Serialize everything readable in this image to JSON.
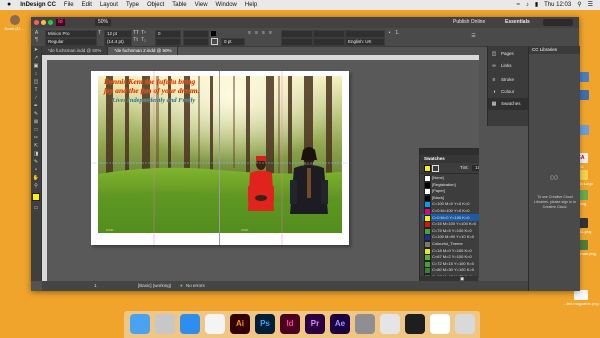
{
  "menubar": {
    "app_name": "InDesign CC",
    "items": [
      "File",
      "Edit",
      "Layout",
      "Type",
      "Object",
      "Table",
      "View",
      "Window",
      "Help"
    ],
    "clock": "Thu 12:03"
  },
  "desktop": {
    "user_label": "Noah (£1 ...",
    "icons": [
      "EA",
      "Ricardo Lego",
      "...png",
      "...ck-11.png",
      "...Fuchsman.png",
      "...ted magazine.png"
    ]
  },
  "indesign": {
    "zoom": "50%",
    "publish_online": "Publish Online",
    "workspace": "Essentials",
    "tabs": [
      "*de fuchsman.indd @ 50%",
      "*de fuchsman 2.indd @ 50%"
    ],
    "control": {
      "font": "Minion Pro",
      "style": "Regular",
      "size": "12 pt",
      "leading": "(14.4 pt)",
      "tracking": "0",
      "stroke": "0 pt",
      "language": "English: UK"
    }
  },
  "document": {
    "headline_line1": "Dennis Kent the fufulu bring",
    "headline_line2": "joy and the fun of your dream.",
    "subheadline": "Lives Independently and Freely"
  },
  "swatches": {
    "title": "Swatches",
    "tint_label": "Tint:",
    "tint_value": "100",
    "items": [
      {
        "label": "[None]",
        "color": "#ffffff"
      },
      {
        "label": "[Registration]",
        "color": "#000000"
      },
      {
        "label": "[Paper]",
        "color": "#ffffff"
      },
      {
        "label": "[Black]",
        "color": "#000000"
      },
      {
        "label": "C=100 M=0 Y=0 K=0",
        "color": "#00a0e9"
      },
      {
        "label": "C=0 M=100 Y=0 K=0",
        "color": "#e4007f"
      },
      {
        "label": "C=0 M=0 Y=100 K=0",
        "color": "#fff100",
        "selected": true
      },
      {
        "label": "C=15 M=100 Y=100 K=0",
        "color": "#d8111e"
      },
      {
        "label": "C=75 M=5 Y=100 K=0",
        "color": "#3aa935"
      },
      {
        "label": "C=100 M=90 Y=10 K=0",
        "color": "#1d2f88"
      },
      {
        "label": "Colourful_Theme",
        "color": "#3d3d3d",
        "group": true
      },
      {
        "label": "C=18 M=0 Y=100 K=0",
        "color": "#e4e72a"
      },
      {
        "label": "C=67 M=2 Y=100 K=0",
        "color": "#5daf34"
      },
      {
        "label": "C=72 M=15 Y=100 K=0",
        "color": "#4b9d38"
      },
      {
        "label": "C=80 M=30 Y=100 K=0",
        "color": "#3d7f38"
      },
      {
        "label": "C=86 M=40 Y=80 K=0",
        "color": "#2b6e56"
      }
    ]
  },
  "panels": {
    "dock_items": [
      "Pages",
      "Links",
      "Stroke",
      "Colour",
      "Swatches"
    ],
    "cc_libraries_title": "CC Libraries",
    "cc_libraries_message": "To use Creative Cloud Libraries, please sign in to Creative Cloud."
  },
  "status": {
    "page": "1",
    "style": "[Basic] (working)",
    "errors": "No errors"
  },
  "dock_apps": [
    {
      "name": "finder-icon",
      "label": "",
      "bg": "#4aa3f0",
      "fg": "#ffffff"
    },
    {
      "name": "launchpad-icon",
      "label": "",
      "bg": "#c7c7c7",
      "fg": "#333333"
    },
    {
      "name": "safari-icon",
      "label": "",
      "bg": "#2d8ef0",
      "fg": "#ffffff"
    },
    {
      "name": "chrome-icon",
      "label": "",
      "bg": "#f4f4f4",
      "fg": "#333333"
    },
    {
      "name": "illustrator-icon",
      "label": "Ai",
      "bg": "#330000",
      "fg": "#ff9a00"
    },
    {
      "name": "photoshop-icon",
      "label": "Ps",
      "bg": "#001e36",
      "fg": "#31a8ff"
    },
    {
      "name": "indesign-icon",
      "label": "Id",
      "bg": "#49021f",
      "fg": "#ff3f94"
    },
    {
      "name": "premiere-icon",
      "label": "Pr",
      "bg": "#2a0040",
      "fg": "#e38bff"
    },
    {
      "name": "after-effects-icon",
      "label": "Ae",
      "bg": "#1a0040",
      "fg": "#9999ff"
    },
    {
      "name": "system-preferences-icon",
      "label": "",
      "bg": "#8e8e93",
      "fg": "#ffffff"
    },
    {
      "name": "folder-icon",
      "label": "",
      "bg": "#e5e5e5",
      "fg": "#333333"
    },
    {
      "name": "screenshot-icon",
      "label": "",
      "bg": "#1e1e1e",
      "fg": "#ffffff"
    },
    {
      "name": "document-icon",
      "label": "",
      "bg": "#ffffff",
      "fg": "#333333"
    },
    {
      "name": "trash-icon",
      "label": "",
      "bg": "#d9d9d9",
      "fg": "#555555"
    }
  ]
}
